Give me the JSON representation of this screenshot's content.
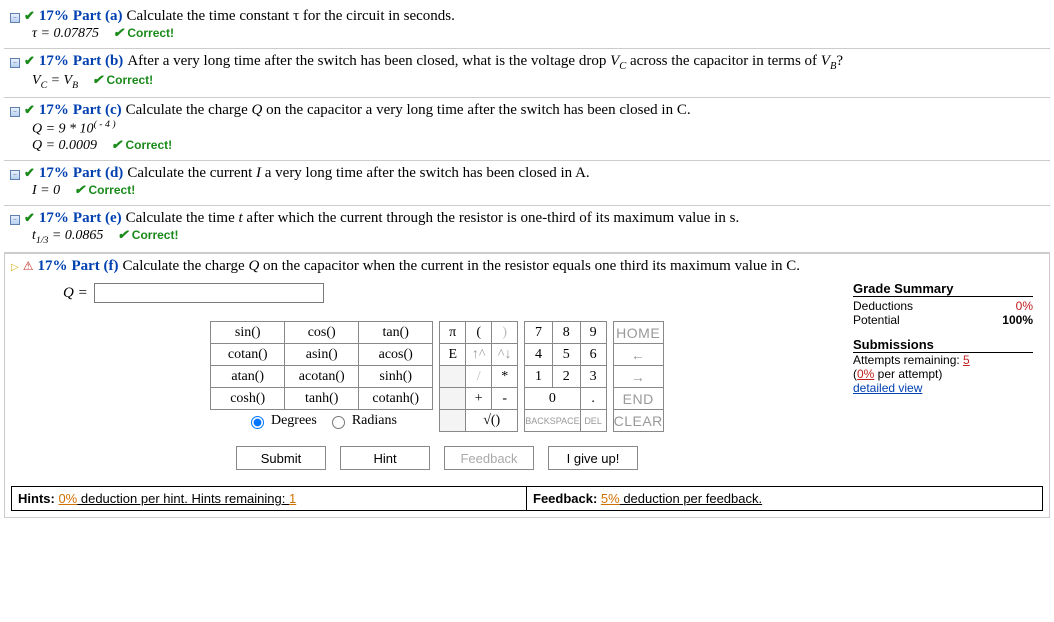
{
  "parts": {
    "a": {
      "pct": "17%",
      "label": "Part (a)",
      "q": "Calculate the time constant τ for the circuit in seconds.",
      "ans": "τ = 0.07875",
      "correct": "Correct!"
    },
    "b": {
      "pct": "17%",
      "label": "Part (b)",
      "q_prefix": "After a very long time after the switch has been closed, what is the voltage drop ",
      "q_mid": " across the capacitor in terms of ",
      "q_end": "?",
      "ans_lhs": "V",
      "ans_sub1": "C",
      "ans_eq": " = V",
      "ans_sub2": "B",
      "correct": "Correct!"
    },
    "c": {
      "pct": "17%",
      "label": "Part (c)",
      "q_prefix": "Calculate the charge ",
      "q_sym": "Q",
      "q_end": " on the capacitor a very long time after the switch has been closed in C.",
      "ans1_lhs": "Q = 9 * 10",
      "ans1_sup": "( - 4 )",
      "ans2": "Q = 0.0009",
      "correct": "Correct!"
    },
    "d": {
      "pct": "17%",
      "label": "Part (d)",
      "q_prefix": "Calculate the current ",
      "q_sym": "I",
      "q_end": " a very long time after the switch has been closed in A.",
      "ans": "I = 0",
      "correct": "Correct!"
    },
    "e": {
      "pct": "17%",
      "label": "Part (e)",
      "q_prefix": "Calculate the time ",
      "q_sym": "t",
      "q_end": " after which the current through the resistor is one-third of its maximum value in s.",
      "ans_lhs": "t",
      "ans_sub": "1/3",
      "ans_rhs": " = 0.0865",
      "correct": "Correct!"
    },
    "f": {
      "pct": "17%",
      "label": "Part (f)",
      "q_prefix": "Calculate the charge ",
      "q_sym": "Q",
      "q_end": " on the capacitor when the current in the resistor equals one third its maximum value in C.",
      "input_label": "Q = "
    }
  },
  "keypad": {
    "funcs": [
      [
        "sin()",
        "cos()",
        "tan()"
      ],
      [
        "cotan()",
        "asin()",
        "acos()"
      ],
      [
        "atan()",
        "acotan()",
        "sinh()"
      ],
      [
        "cosh()",
        "tanh()",
        "cotanh()"
      ]
    ],
    "deg": "Degrees",
    "rad": "Radians",
    "sym": [
      [
        "π",
        "(",
        ")"
      ],
      [
        "E",
        "↑^",
        "^↓"
      ],
      [
        "",
        "/",
        "*"
      ],
      [
        "",
        "+",
        "-"
      ],
      [
        "",
        "√()",
        ""
      ]
    ],
    "nums": [
      [
        "7",
        "8",
        "9"
      ],
      [
        "4",
        "5",
        "6"
      ],
      [
        "1",
        "2",
        "3"
      ],
      [
        "0",
        ".",
        ""
      ],
      [
        "BACKSPACE",
        "DEL",
        ""
      ]
    ],
    "nav": [
      "HOME",
      "←",
      "→",
      "END",
      "CLEAR"
    ],
    "num0": "0",
    "dot": ".",
    "backspace": "BACKSPACE",
    "del": "DEL"
  },
  "actions": {
    "submit": "Submit",
    "hint": "Hint",
    "feedback": "Feedback",
    "giveup": "I give up!"
  },
  "grade": {
    "title": "Grade Summary",
    "ded_label": "Deductions",
    "ded_val": "0%",
    "pot_label": "Potential",
    "pot_val": "100%",
    "sub_title": "Submissions",
    "attempts_label": "Attempts remaining: ",
    "attempts_val": "5",
    "per_attempt_pre": "(",
    "per_attempt_pct": "0%",
    "per_attempt_post": " per attempt)",
    "detailed": "detailed view"
  },
  "hints": {
    "h_label_pre": "Hints: ",
    "h_pct": "0%",
    "h_label_mid": " deduction per hint. Hints remaining: ",
    "h_rem": "1",
    "f_label_pre": "Feedback: ",
    "f_pct": "5%",
    "f_label_post": " deduction per feedback."
  }
}
